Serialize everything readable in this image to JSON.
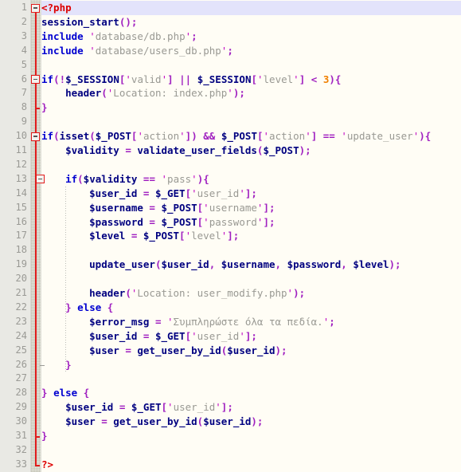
{
  "editor": {
    "language": "PHP",
    "current_line": 1,
    "total_lines": 33,
    "colors": {
      "background": "#fffdf5",
      "gutter_background": "#e9e9e4",
      "current_line_highlight": "#e3e3fb",
      "line_number": "#9a9a95",
      "keyword": "#0000d0",
      "php_tag": "#dd0000",
      "function": "#000080",
      "variable": "#000080",
      "string": "#999993",
      "quote": "#c000c0",
      "operator": "#a020c0",
      "number": "#f08000",
      "fold_marker": "#e01b1b"
    }
  },
  "line_numbers": [
    1,
    2,
    3,
    4,
    5,
    6,
    7,
    8,
    9,
    10,
    11,
    12,
    13,
    14,
    15,
    16,
    17,
    18,
    19,
    20,
    21,
    22,
    23,
    24,
    25,
    26,
    27,
    28,
    29,
    30,
    31,
    32,
    33
  ],
  "fold_markers": [
    {
      "line": 1,
      "state": "expanded",
      "icon": "fold-minus-icon"
    },
    {
      "line": 6,
      "state": "expanded",
      "icon": "fold-minus-icon"
    },
    {
      "line": 10,
      "state": "expanded",
      "icon": "fold-minus-icon"
    },
    {
      "line": 13,
      "state": "expanded",
      "icon": "fold-minus-icon"
    }
  ],
  "code": {
    "plain_text": [
      "<?php",
      "session_start();",
      "include 'database/db.php';",
      "include 'database/users_db.php';",
      "",
      "if(!$_SESSION['valid'] || $_SESSION['level'] < 3){",
      "    header('Location: index.php');",
      "}",
      "",
      "if(isset($_POST['action']) && $_POST['action'] == 'update_user'){",
      "    $validity = validate_user_fields($_POST);",
      "",
      "    if($validity == 'pass'){",
      "        $user_id = $_GET['user_id'];",
      "        $username = $_POST['username'];",
      "        $password = $_POST['password'];",
      "        $level = $_POST['level'];",
      "",
      "        update_user($user_id, $username, $password, $level);",
      "",
      "        header('Location: user_modify.php');",
      "    } else {",
      "        $error_msg = 'Συμπληρώστε όλα τα πεδία.';",
      "        $user_id = $_GET['user_id'];",
      "        $user = get_user_by_id($user_id);",
      "    }",
      "",
      "} else {",
      "    $user_id = $_GET['user_id'];",
      "    $user = get_user_by_id($user_id);",
      "}",
      "",
      "?>"
    ],
    "lines": [
      {
        "n": 1,
        "indent": 0,
        "tokens": [
          [
            "t-tag",
            "<?php"
          ]
        ]
      },
      {
        "n": 2,
        "indent": 0,
        "tokens": [
          [
            "t-fn",
            "session_start"
          ],
          [
            "t-op",
            "();"
          ]
        ]
      },
      {
        "n": 3,
        "indent": 0,
        "tokens": [
          [
            "t-kw",
            "include"
          ],
          [
            "t-pl",
            " "
          ],
          [
            "t-q",
            "'"
          ],
          [
            "t-str",
            "database/db.php"
          ],
          [
            "t-q",
            "'"
          ],
          [
            "t-op",
            ";"
          ]
        ]
      },
      {
        "n": 4,
        "indent": 0,
        "tokens": [
          [
            "t-kw",
            "include"
          ],
          [
            "t-pl",
            " "
          ],
          [
            "t-q",
            "'"
          ],
          [
            "t-str",
            "database/users_db.php"
          ],
          [
            "t-q",
            "'"
          ],
          [
            "t-op",
            ";"
          ]
        ]
      },
      {
        "n": 5,
        "indent": 0,
        "tokens": []
      },
      {
        "n": 6,
        "indent": 0,
        "tokens": [
          [
            "t-kw",
            "if"
          ],
          [
            "t-op",
            "(!"
          ],
          [
            "t-var",
            "$_SESSION"
          ],
          [
            "t-op",
            "["
          ],
          [
            "t-q",
            "'"
          ],
          [
            "t-str",
            "valid"
          ],
          [
            "t-q",
            "'"
          ],
          [
            "t-op",
            "] || "
          ],
          [
            "t-var",
            "$_SESSION"
          ],
          [
            "t-op",
            "["
          ],
          [
            "t-q",
            "'"
          ],
          [
            "t-str",
            "level"
          ],
          [
            "t-q",
            "'"
          ],
          [
            "t-op",
            "] < "
          ],
          [
            "t-num",
            "3"
          ],
          [
            "t-op",
            "){"
          ]
        ]
      },
      {
        "n": 7,
        "indent": 1,
        "tokens": [
          [
            "t-fn",
            "header"
          ],
          [
            "t-op",
            "("
          ],
          [
            "t-q",
            "'"
          ],
          [
            "t-str",
            "Location: index.php"
          ],
          [
            "t-q",
            "'"
          ],
          [
            "t-op",
            ");"
          ]
        ]
      },
      {
        "n": 8,
        "indent": 0,
        "tokens": [
          [
            "t-op",
            "}"
          ]
        ]
      },
      {
        "n": 9,
        "indent": 0,
        "tokens": []
      },
      {
        "n": 10,
        "indent": 0,
        "tokens": [
          [
            "t-kw",
            "if"
          ],
          [
            "t-op",
            "("
          ],
          [
            "t-fn",
            "isset"
          ],
          [
            "t-op",
            "("
          ],
          [
            "t-var",
            "$_POST"
          ],
          [
            "t-op",
            "["
          ],
          [
            "t-q",
            "'"
          ],
          [
            "t-str",
            "action"
          ],
          [
            "t-q",
            "'"
          ],
          [
            "t-op",
            "]) && "
          ],
          [
            "t-var",
            "$_POST"
          ],
          [
            "t-op",
            "["
          ],
          [
            "t-q",
            "'"
          ],
          [
            "t-str",
            "action"
          ],
          [
            "t-q",
            "'"
          ],
          [
            "t-op",
            "] == "
          ],
          [
            "t-q",
            "'"
          ],
          [
            "t-str",
            "update_user"
          ],
          [
            "t-q",
            "'"
          ],
          [
            "t-op",
            "){"
          ]
        ]
      },
      {
        "n": 11,
        "indent": 1,
        "tokens": [
          [
            "t-var",
            "$validity"
          ],
          [
            "t-op",
            " = "
          ],
          [
            "t-fn",
            "validate_user_fields"
          ],
          [
            "t-op",
            "("
          ],
          [
            "t-var",
            "$_POST"
          ],
          [
            "t-op",
            ");"
          ]
        ]
      },
      {
        "n": 12,
        "indent": 0,
        "tokens": []
      },
      {
        "n": 13,
        "indent": 1,
        "tokens": [
          [
            "t-kw",
            "if"
          ],
          [
            "t-op",
            "("
          ],
          [
            "t-var",
            "$validity"
          ],
          [
            "t-op",
            " == "
          ],
          [
            "t-q",
            "'"
          ],
          [
            "t-str",
            "pass"
          ],
          [
            "t-q",
            "'"
          ],
          [
            "t-op",
            "){"
          ]
        ]
      },
      {
        "n": 14,
        "indent": 2,
        "tokens": [
          [
            "t-var",
            "$user_id"
          ],
          [
            "t-op",
            " = "
          ],
          [
            "t-var",
            "$_GET"
          ],
          [
            "t-op",
            "["
          ],
          [
            "t-q",
            "'"
          ],
          [
            "t-str",
            "user_id"
          ],
          [
            "t-q",
            "'"
          ],
          [
            "t-op",
            "];"
          ]
        ]
      },
      {
        "n": 15,
        "indent": 2,
        "tokens": [
          [
            "t-var",
            "$username"
          ],
          [
            "t-op",
            " = "
          ],
          [
            "t-var",
            "$_POST"
          ],
          [
            "t-op",
            "["
          ],
          [
            "t-q",
            "'"
          ],
          [
            "t-str",
            "username"
          ],
          [
            "t-q",
            "'"
          ],
          [
            "t-op",
            "];"
          ]
        ]
      },
      {
        "n": 16,
        "indent": 2,
        "tokens": [
          [
            "t-var",
            "$password"
          ],
          [
            "t-op",
            " = "
          ],
          [
            "t-var",
            "$_POST"
          ],
          [
            "t-op",
            "["
          ],
          [
            "t-q",
            "'"
          ],
          [
            "t-str",
            "password"
          ],
          [
            "t-q",
            "'"
          ],
          [
            "t-op",
            "];"
          ]
        ]
      },
      {
        "n": 17,
        "indent": 2,
        "tokens": [
          [
            "t-var",
            "$level"
          ],
          [
            "t-op",
            " = "
          ],
          [
            "t-var",
            "$_POST"
          ],
          [
            "t-op",
            "["
          ],
          [
            "t-q",
            "'"
          ],
          [
            "t-str",
            "level"
          ],
          [
            "t-q",
            "'"
          ],
          [
            "t-op",
            "];"
          ]
        ]
      },
      {
        "n": 18,
        "indent": 0,
        "tokens": []
      },
      {
        "n": 19,
        "indent": 2,
        "tokens": [
          [
            "t-fn",
            "update_user"
          ],
          [
            "t-op",
            "("
          ],
          [
            "t-var",
            "$user_id"
          ],
          [
            "t-op",
            ", "
          ],
          [
            "t-var",
            "$username"
          ],
          [
            "t-op",
            ", "
          ],
          [
            "t-var",
            "$password"
          ],
          [
            "t-op",
            ", "
          ],
          [
            "t-var",
            "$level"
          ],
          [
            "t-op",
            ");"
          ]
        ]
      },
      {
        "n": 20,
        "indent": 0,
        "tokens": []
      },
      {
        "n": 21,
        "indent": 2,
        "tokens": [
          [
            "t-fn",
            "header"
          ],
          [
            "t-op",
            "("
          ],
          [
            "t-q",
            "'"
          ],
          [
            "t-str",
            "Location: user_modify.php"
          ],
          [
            "t-q",
            "'"
          ],
          [
            "t-op",
            ");"
          ]
        ]
      },
      {
        "n": 22,
        "indent": 1,
        "tokens": [
          [
            "t-op",
            "} "
          ],
          [
            "t-kw",
            "else"
          ],
          [
            "t-op",
            " {"
          ]
        ]
      },
      {
        "n": 23,
        "indent": 2,
        "tokens": [
          [
            "t-var",
            "$error_msg"
          ],
          [
            "t-op",
            " = "
          ],
          [
            "t-q",
            "'"
          ],
          [
            "t-str",
            "Συμπληρώστε όλα τα πεδία."
          ],
          [
            "t-q",
            "'"
          ],
          [
            "t-op",
            ";"
          ]
        ]
      },
      {
        "n": 24,
        "indent": 2,
        "tokens": [
          [
            "t-var",
            "$user_id"
          ],
          [
            "t-op",
            " = "
          ],
          [
            "t-var",
            "$_GET"
          ],
          [
            "t-op",
            "["
          ],
          [
            "t-q",
            "'"
          ],
          [
            "t-str",
            "user_id"
          ],
          [
            "t-q",
            "'"
          ],
          [
            "t-op",
            "];"
          ]
        ]
      },
      {
        "n": 25,
        "indent": 2,
        "tokens": [
          [
            "t-var",
            "$user"
          ],
          [
            "t-op",
            " = "
          ],
          [
            "t-fn",
            "get_user_by_id"
          ],
          [
            "t-op",
            "("
          ],
          [
            "t-var",
            "$user_id"
          ],
          [
            "t-op",
            ");"
          ]
        ]
      },
      {
        "n": 26,
        "indent": 1,
        "tokens": [
          [
            "t-op",
            "}"
          ]
        ]
      },
      {
        "n": 27,
        "indent": 0,
        "tokens": []
      },
      {
        "n": 28,
        "indent": 0,
        "tokens": [
          [
            "t-op",
            "} "
          ],
          [
            "t-kw",
            "else"
          ],
          [
            "t-op",
            " {"
          ]
        ]
      },
      {
        "n": 29,
        "indent": 1,
        "tokens": [
          [
            "t-var",
            "$user_id"
          ],
          [
            "t-op",
            " = "
          ],
          [
            "t-var",
            "$_GET"
          ],
          [
            "t-op",
            "["
          ],
          [
            "t-q",
            "'"
          ],
          [
            "t-str",
            "user_id"
          ],
          [
            "t-q",
            "'"
          ],
          [
            "t-op",
            "];"
          ]
        ]
      },
      {
        "n": 30,
        "indent": 1,
        "tokens": [
          [
            "t-var",
            "$user"
          ],
          [
            "t-op",
            " = "
          ],
          [
            "t-fn",
            "get_user_by_id"
          ],
          [
            "t-op",
            "("
          ],
          [
            "t-var",
            "$user_id"
          ],
          [
            "t-op",
            ");"
          ]
        ]
      },
      {
        "n": 31,
        "indent": 0,
        "tokens": [
          [
            "t-op",
            "}"
          ]
        ]
      },
      {
        "n": 32,
        "indent": 0,
        "tokens": []
      },
      {
        "n": 33,
        "indent": 0,
        "tokens": [
          [
            "t-tag",
            "?>"
          ]
        ]
      }
    ]
  }
}
